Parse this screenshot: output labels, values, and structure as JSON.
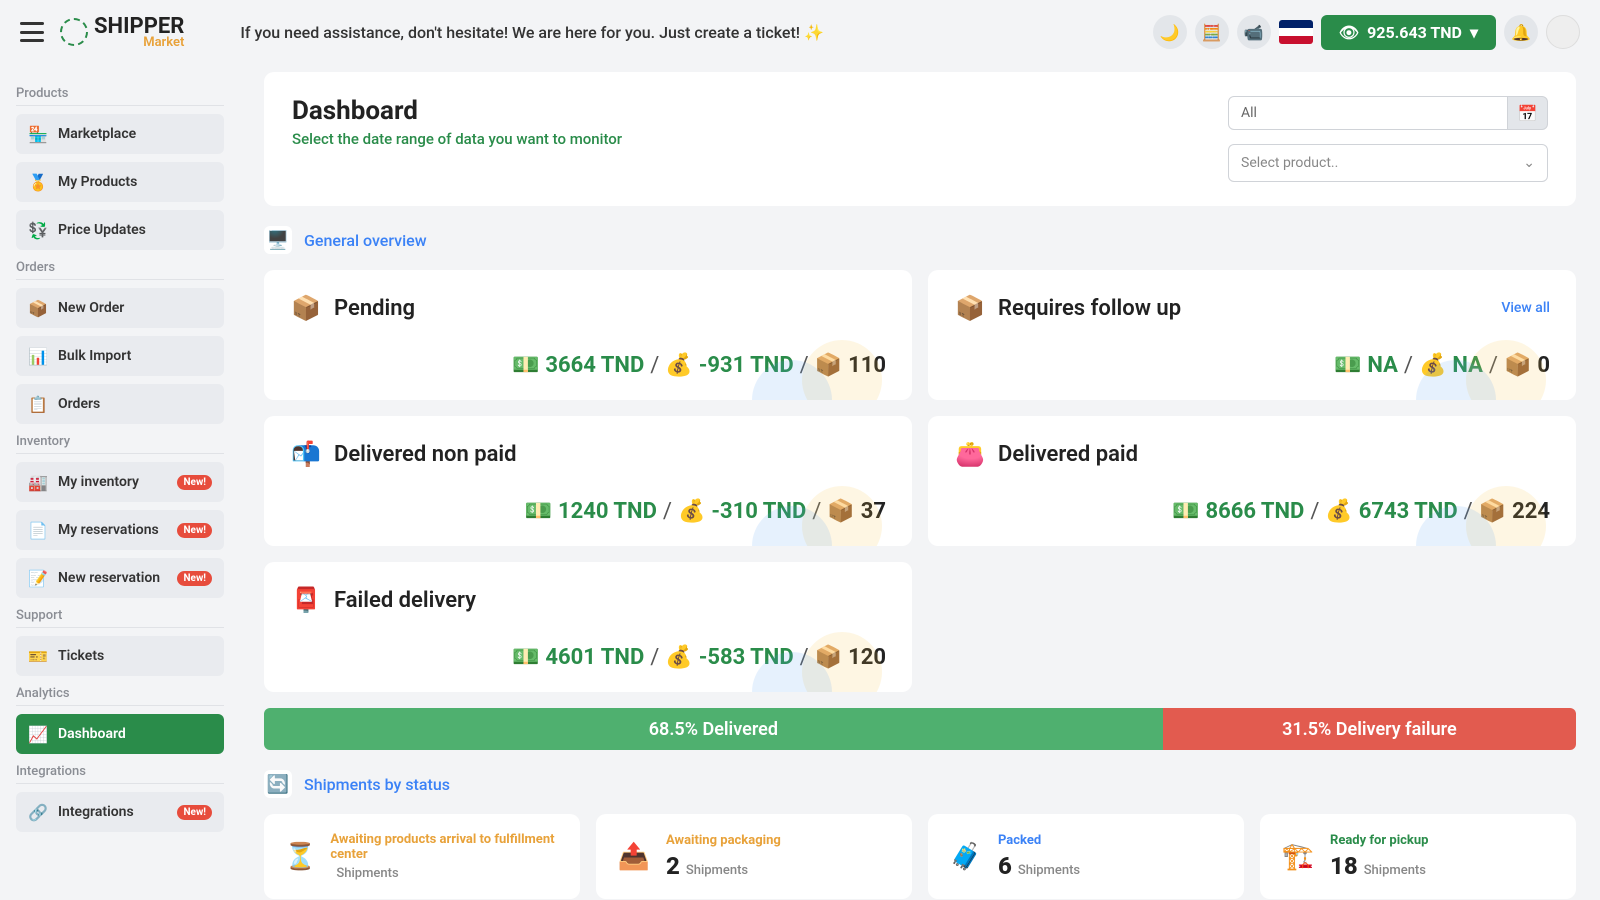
{
  "header": {
    "assist_text": "If you need assistance, don't hesitate! We are here for you. Just create a ticket! ✨",
    "balance": "925.643 TND",
    "logo_main": "SHIPPER",
    "logo_sub": "Market"
  },
  "sidebar": {
    "groups": [
      {
        "label": "Products",
        "items": [
          {
            "label": "Marketplace",
            "icon": "🏪"
          },
          {
            "label": "My Products",
            "icon": "🏅"
          },
          {
            "label": "Price Updates",
            "icon": "💱"
          }
        ]
      },
      {
        "label": "Orders",
        "items": [
          {
            "label": "New Order",
            "icon": "📦"
          },
          {
            "label": "Bulk Import",
            "icon": "📊"
          },
          {
            "label": "Orders",
            "icon": "📋"
          }
        ]
      },
      {
        "label": "Inventory",
        "items": [
          {
            "label": "My inventory",
            "icon": "🏭",
            "badge": "New!"
          },
          {
            "label": "My reservations",
            "icon": "📄",
            "badge": "New!"
          },
          {
            "label": "New reservation",
            "icon": "📝",
            "badge": "New!"
          }
        ]
      },
      {
        "label": "Support",
        "items": [
          {
            "label": "Tickets",
            "icon": "🎫"
          }
        ]
      },
      {
        "label": "Analytics",
        "items": [
          {
            "label": "Dashboard",
            "icon": "📈",
            "active": true
          }
        ]
      },
      {
        "label": "Integrations",
        "items": [
          {
            "label": "Integrations",
            "icon": "🔗",
            "badge": "New!"
          }
        ]
      }
    ]
  },
  "dashboard": {
    "title": "Dashboard",
    "subtitle": "Select the date range of data you want to monitor",
    "filter_all": "All",
    "filter_product": "Select product..",
    "overview_title": "General overview",
    "shipments_title": "Shipments by status",
    "view_all_label": "View all",
    "overview": [
      {
        "title": "Pending",
        "icon": "📦",
        "v1": "3664 TND",
        "v2": "-931 TND",
        "v3": "110"
      },
      {
        "title": "Requires follow up",
        "icon": "📦",
        "v1": "NA",
        "v2": "NA",
        "v3": "0",
        "view_all": true
      },
      {
        "title": "Delivered non paid",
        "icon": "📬",
        "v1": "1240 TND",
        "v2": "-310 TND",
        "v3": "37"
      },
      {
        "title": "Delivered paid",
        "icon": "👛",
        "v1": "8666 TND",
        "v2": "6743 TND",
        "v3": "224"
      },
      {
        "title": "Failed delivery",
        "icon": "📮",
        "v1": "4601 TND",
        "v2": "-583 TND",
        "v3": "120"
      }
    ],
    "progress": {
      "delivered_pct": 68.5,
      "failure_pct": 31.5,
      "delivered_label": "68.5% Delivered",
      "failure_label": "31.5% Delivery failure"
    },
    "status": [
      {
        "title": "Awaiting products arrival to fulfillment center",
        "count": "",
        "label": "Shipments",
        "icon": "⏳",
        "color": "orange"
      },
      {
        "title": "Awaiting packaging",
        "count": "2",
        "label": "Shipments",
        "icon": "📤",
        "color": "orange"
      },
      {
        "title": "Packed",
        "count": "6",
        "label": "Shipments",
        "icon": "🧳",
        "color": "blue"
      },
      {
        "title": "Ready for pickup",
        "count": "18",
        "label": "Shipments",
        "icon": "🏗️",
        "color": "green"
      }
    ]
  }
}
